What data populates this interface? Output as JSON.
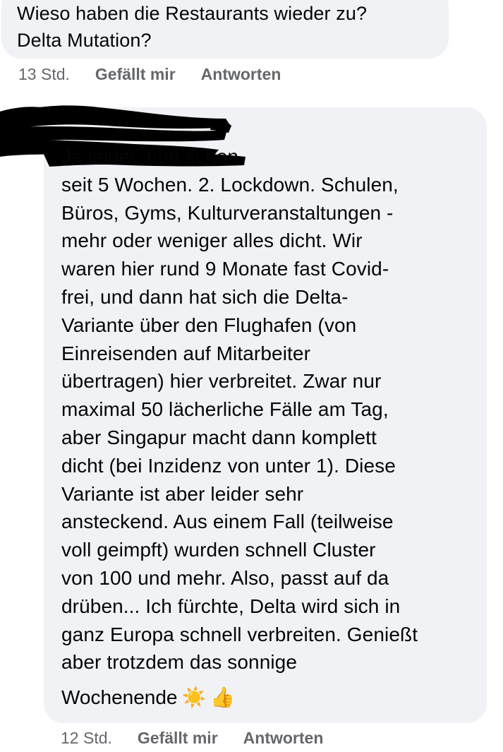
{
  "top_comment": {
    "text": "Wieso haben die Restaurants wieder zu?\nDelta Mutation?",
    "time": "13 Std.",
    "like_label": "Gefällt mir",
    "reply_label": "Antworten"
  },
  "reply": {
    "body": "Ja leider, nun schon\nseit 5 Wochen. 2. Lockdown. Schulen,\nBüros, Gyms, Kulturveranstaltungen -\nmehr oder weniger alles dicht. Wir\nwaren hier rund 9 Monate fast Covid-\nfrei, und dann hat sich die Delta-\nVariante über den Flughafen (von\nEinreisenden auf Mitarbeiter\nübertragen) hier verbreitet. Zwar nur\nmaximal 50 lächerliche Fälle am Tag,\naber Singapur macht dann komplett\ndicht (bei Inzidenz von unter 1). Diese\nVariante ist aber leider sehr\nansteckend. Aus einem Fall (teilweise\nvoll geimpft) wurden schnell Cluster\nvon 100 und mehr. Also, passt auf da\ndrüben... Ich fürchte, Delta wird sich in\nganz Europa schnell verbreiten. Genießt\naber trotzdem das sonnige",
    "last_line": "Wochenende",
    "emoji_sun": "☀️",
    "emoji_thumbs": "👍",
    "time": "12 Std.",
    "like_label": "Gefällt mir",
    "reply_label": "Antworten"
  },
  "colors": {
    "bubble": "#f0f2f5",
    "meta_text": "#65676b",
    "text": "#050505",
    "redaction": "#000000"
  }
}
